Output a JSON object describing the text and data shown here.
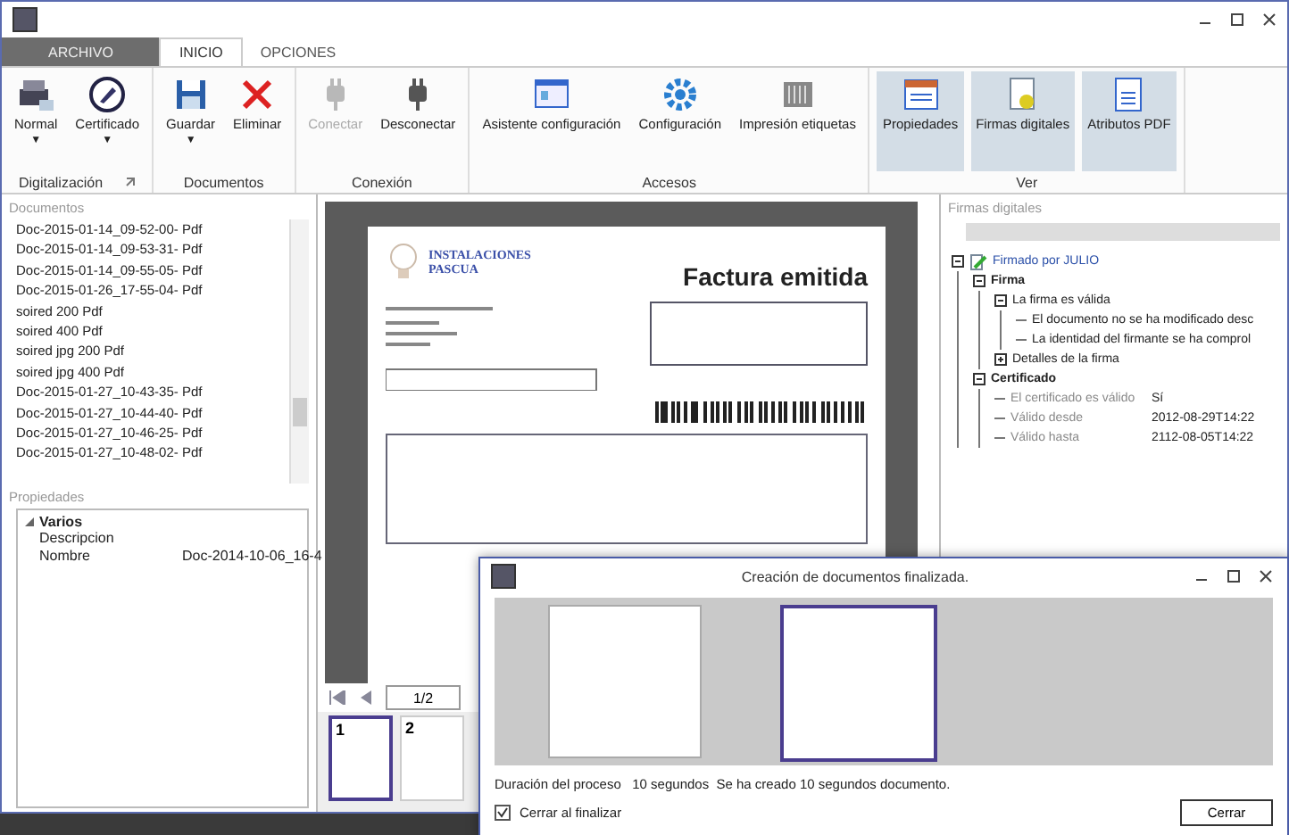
{
  "tabs": [
    {
      "label": "ARCHIVO",
      "kind": "file",
      "selected": false
    },
    {
      "label": "INICIO",
      "kind": "tab",
      "selected": true
    },
    {
      "label": "OPCIONES",
      "kind": "tab",
      "selected": false
    }
  ],
  "ribbon": [
    {
      "label": "Digitalización",
      "launcher": true,
      "buttons": [
        {
          "label": "Normal",
          "caret": "▼",
          "disabled": false,
          "on": false
        },
        {
          "label": "Certificado",
          "caret": "▼",
          "disabled": false,
          "on": false
        }
      ]
    },
    {
      "label": "Documentos",
      "launcher": false,
      "buttons": [
        {
          "label": "Guardar",
          "caret": "▼",
          "disabled": false,
          "on": false
        },
        {
          "label": "Eliminar",
          "disabled": false,
          "on": false
        }
      ]
    },
    {
      "label": "Conexión",
      "launcher": false,
      "buttons": [
        {
          "label": "Conectar",
          "disabled": true,
          "on": false
        },
        {
          "label": "Desconectar",
          "disabled": false,
          "on": false
        }
      ]
    },
    {
      "label": "Accesos",
      "launcher": false,
      "buttons": [
        {
          "label": "Asistente configuración",
          "disabled": false,
          "on": false
        },
        {
          "label": "Configuración",
          "disabled": false,
          "on": false
        },
        {
          "label": "Impresión etiquetas",
          "disabled": false,
          "on": false
        }
      ]
    },
    {
      "label": "Ver",
      "launcher": false,
      "buttons": [
        {
          "label": "Propiedades",
          "disabled": false,
          "on": true
        },
        {
          "label": "Firmas digitales",
          "disabled": false,
          "on": true
        },
        {
          "label": "Atributos PDF",
          "disabled": false,
          "on": true
        }
      ]
    }
  ],
  "documents": {
    "title": "Documentos",
    "items": [
      "Doc-2015-01-14_09-52-00- Pdf",
      "Doc-2015-01-14_09-53-31- Pdf",
      "Doc-2015-01-14_09-55-05- Pdf",
      "Doc-2015-01-26_17-55-04- Pdf",
      "soired 200 Pdf",
      "soired 400 Pdf",
      "soired jpg 200 Pdf",
      "soired jpg 400 Pdf",
      "Doc-2015-01-27_10-43-35- Pdf",
      "Doc-2015-01-27_10-44-40- Pdf",
      "Doc-2015-01-27_10-46-25- Pdf",
      "Doc-2015-01-27_10-48-02- Pdf"
    ]
  },
  "properties": {
    "title": "Propiedades",
    "category": "Varios",
    "expanded": true,
    "rows": [
      {
        "name": "Descripcion",
        "value": ""
      },
      {
        "name": "Nombre",
        "value": "Doc-2014-10-06_16-4"
      }
    ]
  },
  "viewer": {
    "page": {
      "company": "INSTALACIONES PASCUA",
      "heading": "Factura emitida"
    },
    "page_field": "1/2",
    "thumbnails": [
      {
        "label": "1",
        "selected": true
      },
      {
        "label": "2",
        "selected": false
      }
    ]
  },
  "signatures": {
    "title": "Firmas digitales",
    "tree": [
      {
        "label": "Firmado por JULIO",
        "kind": "signer",
        "expanded": true,
        "children": [
          {
            "label": "Firma",
            "kind": "bold",
            "expanded": true,
            "children": [
              {
                "label": "La firma es válida",
                "kind": "plain",
                "expanded": true,
                "children": [
                  {
                    "label": "El documento no se ha modificado desc",
                    "kind": "plain"
                  },
                  {
                    "label": "La identidad del firmante se ha comprol",
                    "kind": "plain"
                  }
                ]
              },
              {
                "label": "Detalles de la firma",
                "kind": "plain",
                "expanded": false
              }
            ]
          },
          {
            "label": "Certificado",
            "kind": "bold",
            "expanded": true,
            "children": [
              {
                "label": "El certificado es válido",
                "kind": "field",
                "value": "Sí"
              },
              {
                "label": "Válido desde",
                "kind": "field",
                "value": "2012-08-29T14:22"
              },
              {
                "label": "Válido hasta",
                "kind": "field",
                "value": "2112-08-05T14:22"
              }
            ]
          }
        ]
      }
    ]
  },
  "dialog": {
    "title": "Creación de documentos finalizada.",
    "previews": [
      {
        "selected": false
      },
      {
        "selected": true
      }
    ],
    "status": "Duración del proceso   10 segundos  Se ha creado 10 segundos documento.",
    "close_on_finish": {
      "label": "Cerrar al finalizar",
      "checked": true
    },
    "button": "Cerrar"
  }
}
